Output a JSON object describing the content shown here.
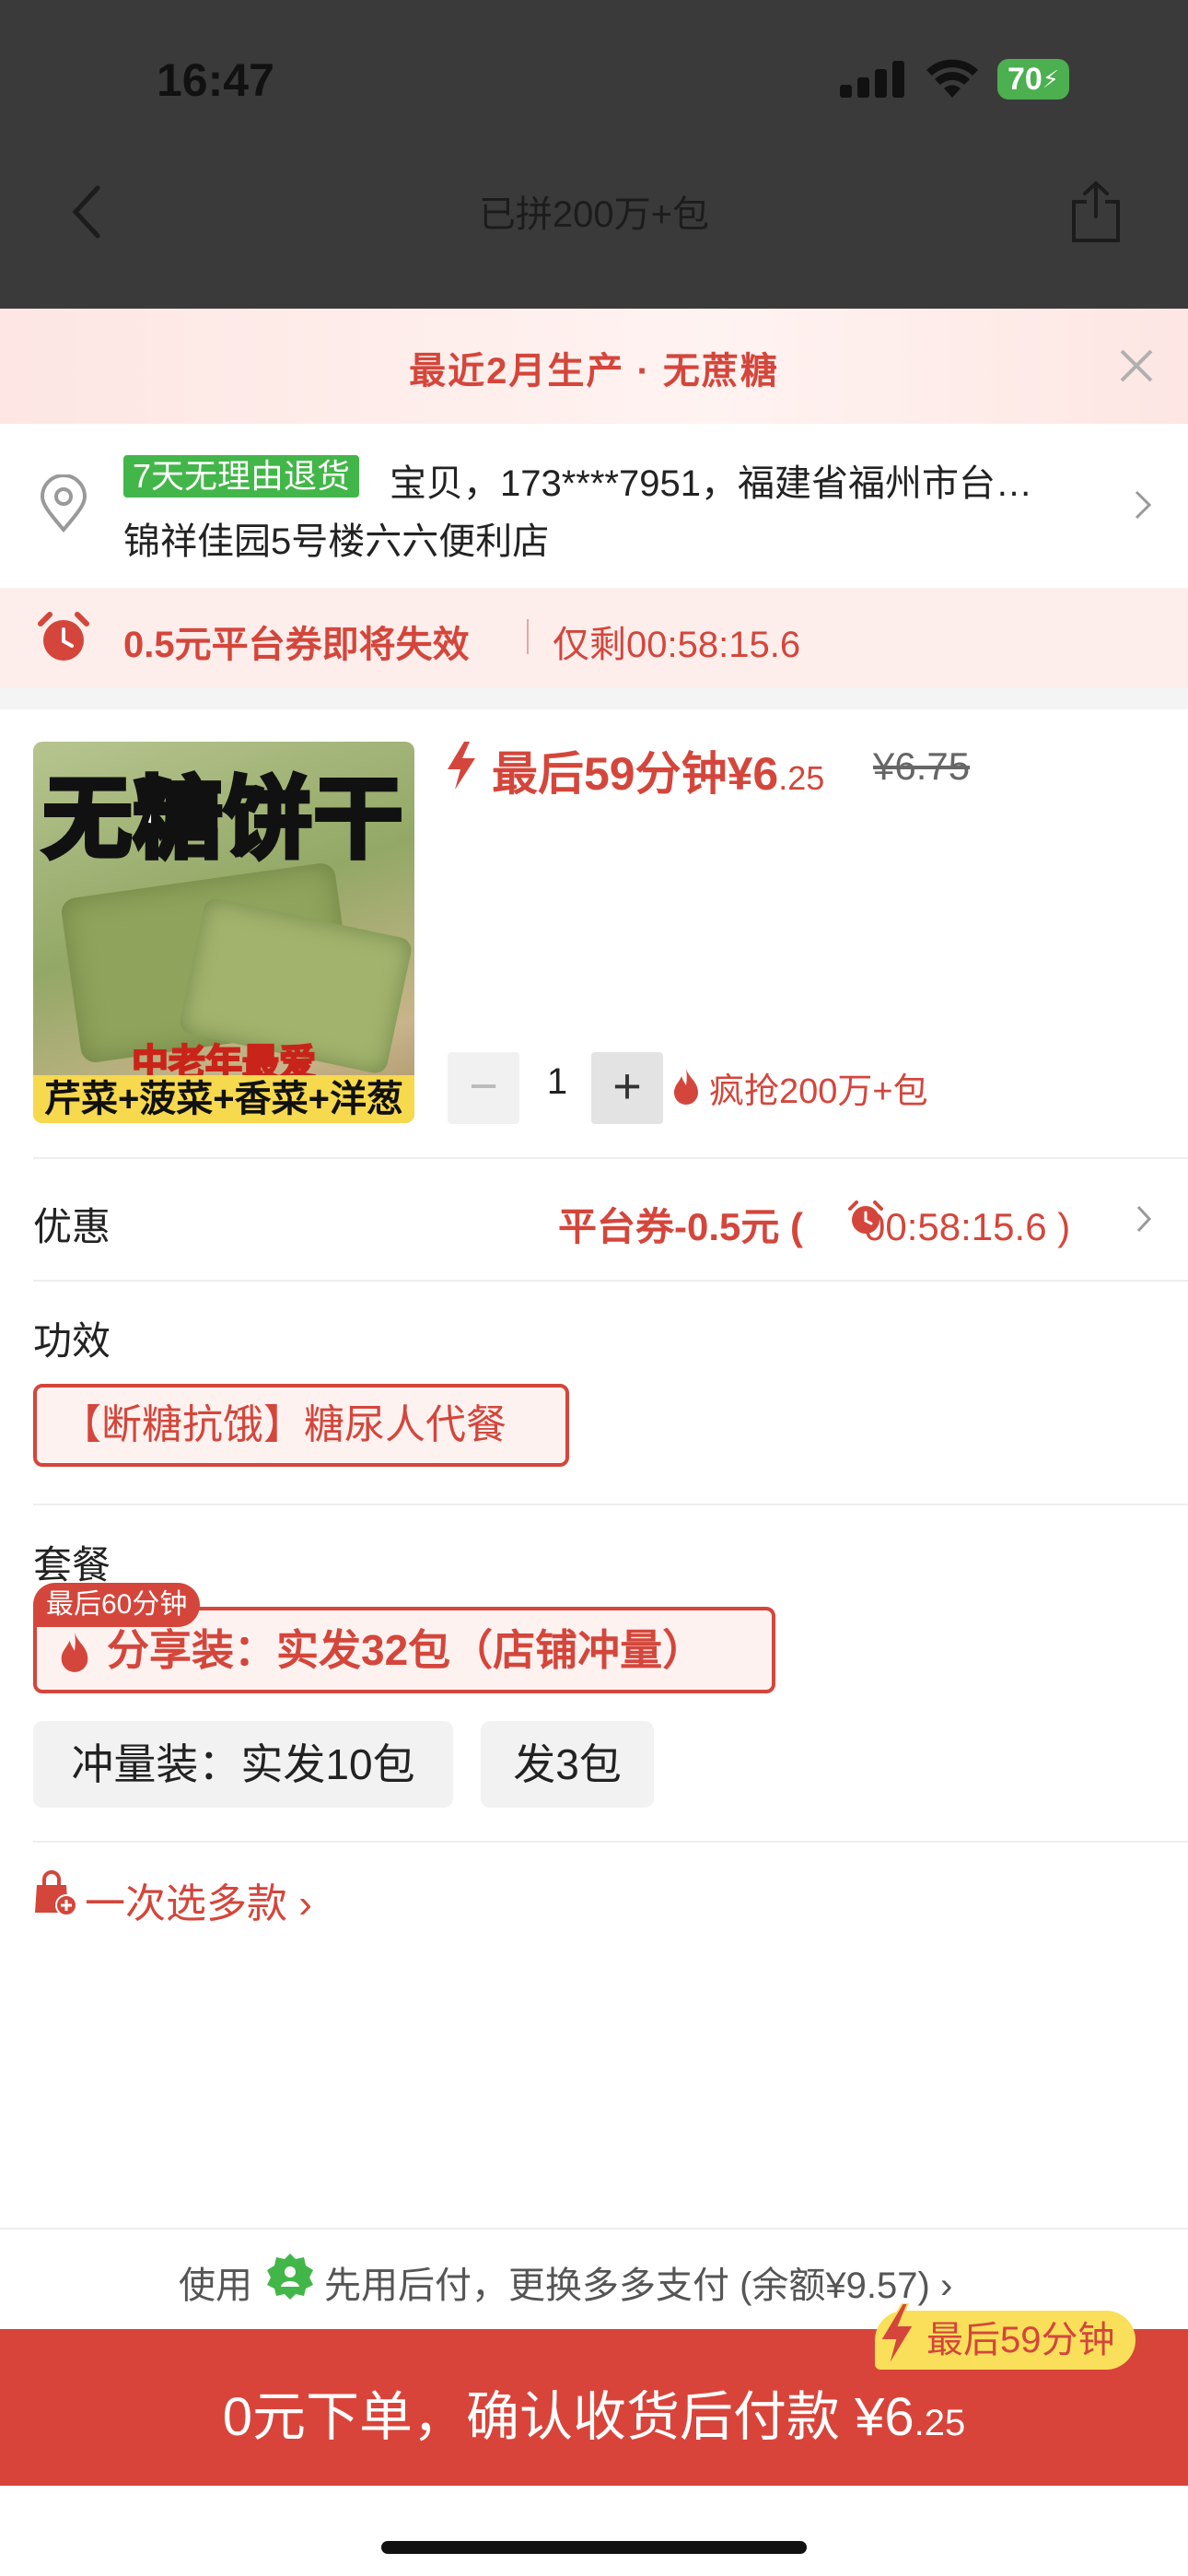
{
  "status": {
    "time": "16:47",
    "battery": "70"
  },
  "header": {
    "title": "已拼200万+包"
  },
  "banner": {
    "text": "最近2月生产 · 无蔗糖"
  },
  "address": {
    "tag": "7天无理由退货",
    "line1": "宝贝，173****7951，福建省福州市台…",
    "line2": "锦祥佳园5号楼六六便利店"
  },
  "coupon_bar": {
    "text": "0.5元平台券即将失效",
    "remain": "仅剩00:58:15.6"
  },
  "product": {
    "image_title": "无糖饼干",
    "image_sub": "中老年最爱",
    "image_strip": "芹菜+菠菜+香菜+洋葱",
    "price_label": "最后59分钟¥6",
    "price_decimal": ".25",
    "price_old": "¥6.75",
    "qty_minus": "−",
    "quantity": "1",
    "qty_plus": "+",
    "sold": "疯抢200万+包"
  },
  "discount": {
    "label": "优惠",
    "value_prefix": "平台券-0.5元 (",
    "timer": "00:58:15.6 )"
  },
  "efficacy": {
    "label": "功效",
    "option": "【断糖抗饿】糖尿人代餐"
  },
  "package": {
    "label": "套餐",
    "badge": "最后60分钟",
    "selected": "分享装：实发32包（店铺冲量）",
    "options": [
      "冲量装：实发10包",
      "发3包"
    ]
  },
  "multi": {
    "text": "一次选多款 ›"
  },
  "pay": {
    "prefix": "使用",
    "text": "先用后付，更换多多支付 (余额¥9.57) ›"
  },
  "buy": {
    "text": "0元下单，确认收货后付款 ¥6",
    "decimal": ".25",
    "tag": "最后59分钟"
  },
  "colors": {
    "accent": "#d4463b",
    "green": "#43b649",
    "buy_bar": "#d8443a",
    "tag_yellow": "#f9df5a"
  }
}
